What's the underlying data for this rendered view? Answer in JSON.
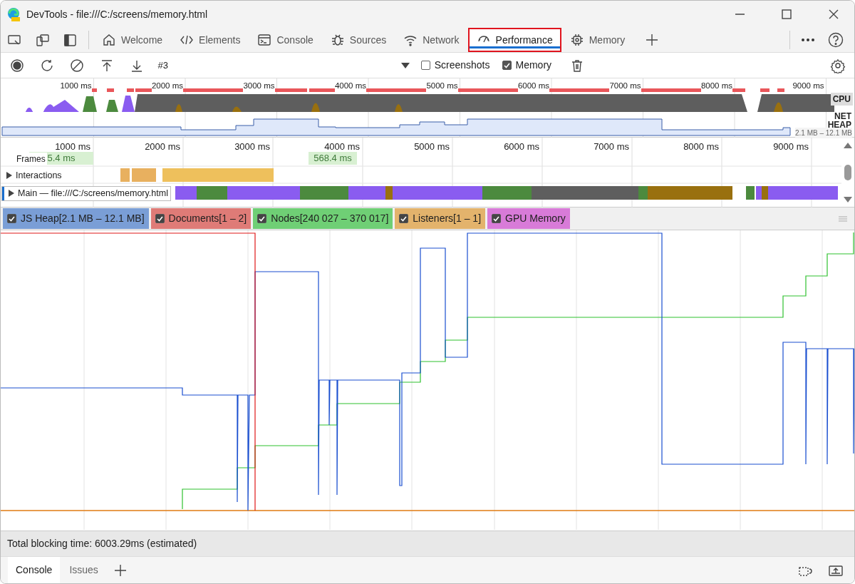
{
  "window": {
    "title": "DevTools - file:///C:/screens/memory.html"
  },
  "tabs": [
    {
      "label": "Welcome",
      "selected": false
    },
    {
      "label": "Elements",
      "selected": false
    },
    {
      "label": "Console",
      "selected": false
    },
    {
      "label": "Sources",
      "selected": false
    },
    {
      "label": "Network",
      "selected": false
    },
    {
      "label": "Performance",
      "selected": true
    },
    {
      "label": "Memory",
      "selected": false
    }
  ],
  "toolbar": {
    "recording": "#3",
    "checkboxes": [
      {
        "label": "Screenshots",
        "checked": false
      },
      {
        "label": "Memory",
        "checked": true
      }
    ]
  },
  "overview": {
    "ticks": [
      "1000 ms",
      "2000 ms",
      "3000 ms",
      "4000 ms",
      "5000 ms",
      "6000 ms",
      "7000 ms",
      "8000 ms",
      "9000 ms"
    ],
    "cpu_label": "CPU",
    "heap_label": "NET\nHEAP",
    "heap_range": "2.1 MB – 12.1 MB"
  },
  "timeline": {
    "ticks": [
      "1000 ms",
      "2000 ms",
      "3000 ms",
      "4000 ms",
      "5000 ms",
      "6000 ms",
      "7000 ms",
      "8000 ms",
      "9000 ms"
    ],
    "frames": {
      "label": "Frames",
      "blocks": [
        "5.4 ms",
        "568.4 ms"
      ]
    },
    "tracks": [
      {
        "label": "Interactions",
        "expanded": false,
        "selected": false
      },
      {
        "label": "Main — file:///C:/screens/memory.html",
        "expanded": false,
        "selected": true
      }
    ]
  },
  "counters": [
    {
      "label": "JS Heap[2.1 MB – 12.1 MB]",
      "checked": true,
      "color": "#7a9ed6"
    },
    {
      "label": "Documents[1 – 2]",
      "checked": true,
      "color": "#df7b77"
    },
    {
      "label": "Nodes[240 027 – 370 017]",
      "checked": true,
      "color": "#6fcf75"
    },
    {
      "label": "Listeners[1 – 1]",
      "checked": true,
      "color": "#e3b36c"
    },
    {
      "label": "GPU Memory",
      "checked": true,
      "color": "#d87bd8"
    }
  ],
  "status_bar": "Total blocking time: 6003.29ms (estimated)",
  "drawer_tabs": [
    {
      "label": "Console",
      "selected": true
    },
    {
      "label": "Issues",
      "selected": false
    }
  ]
}
